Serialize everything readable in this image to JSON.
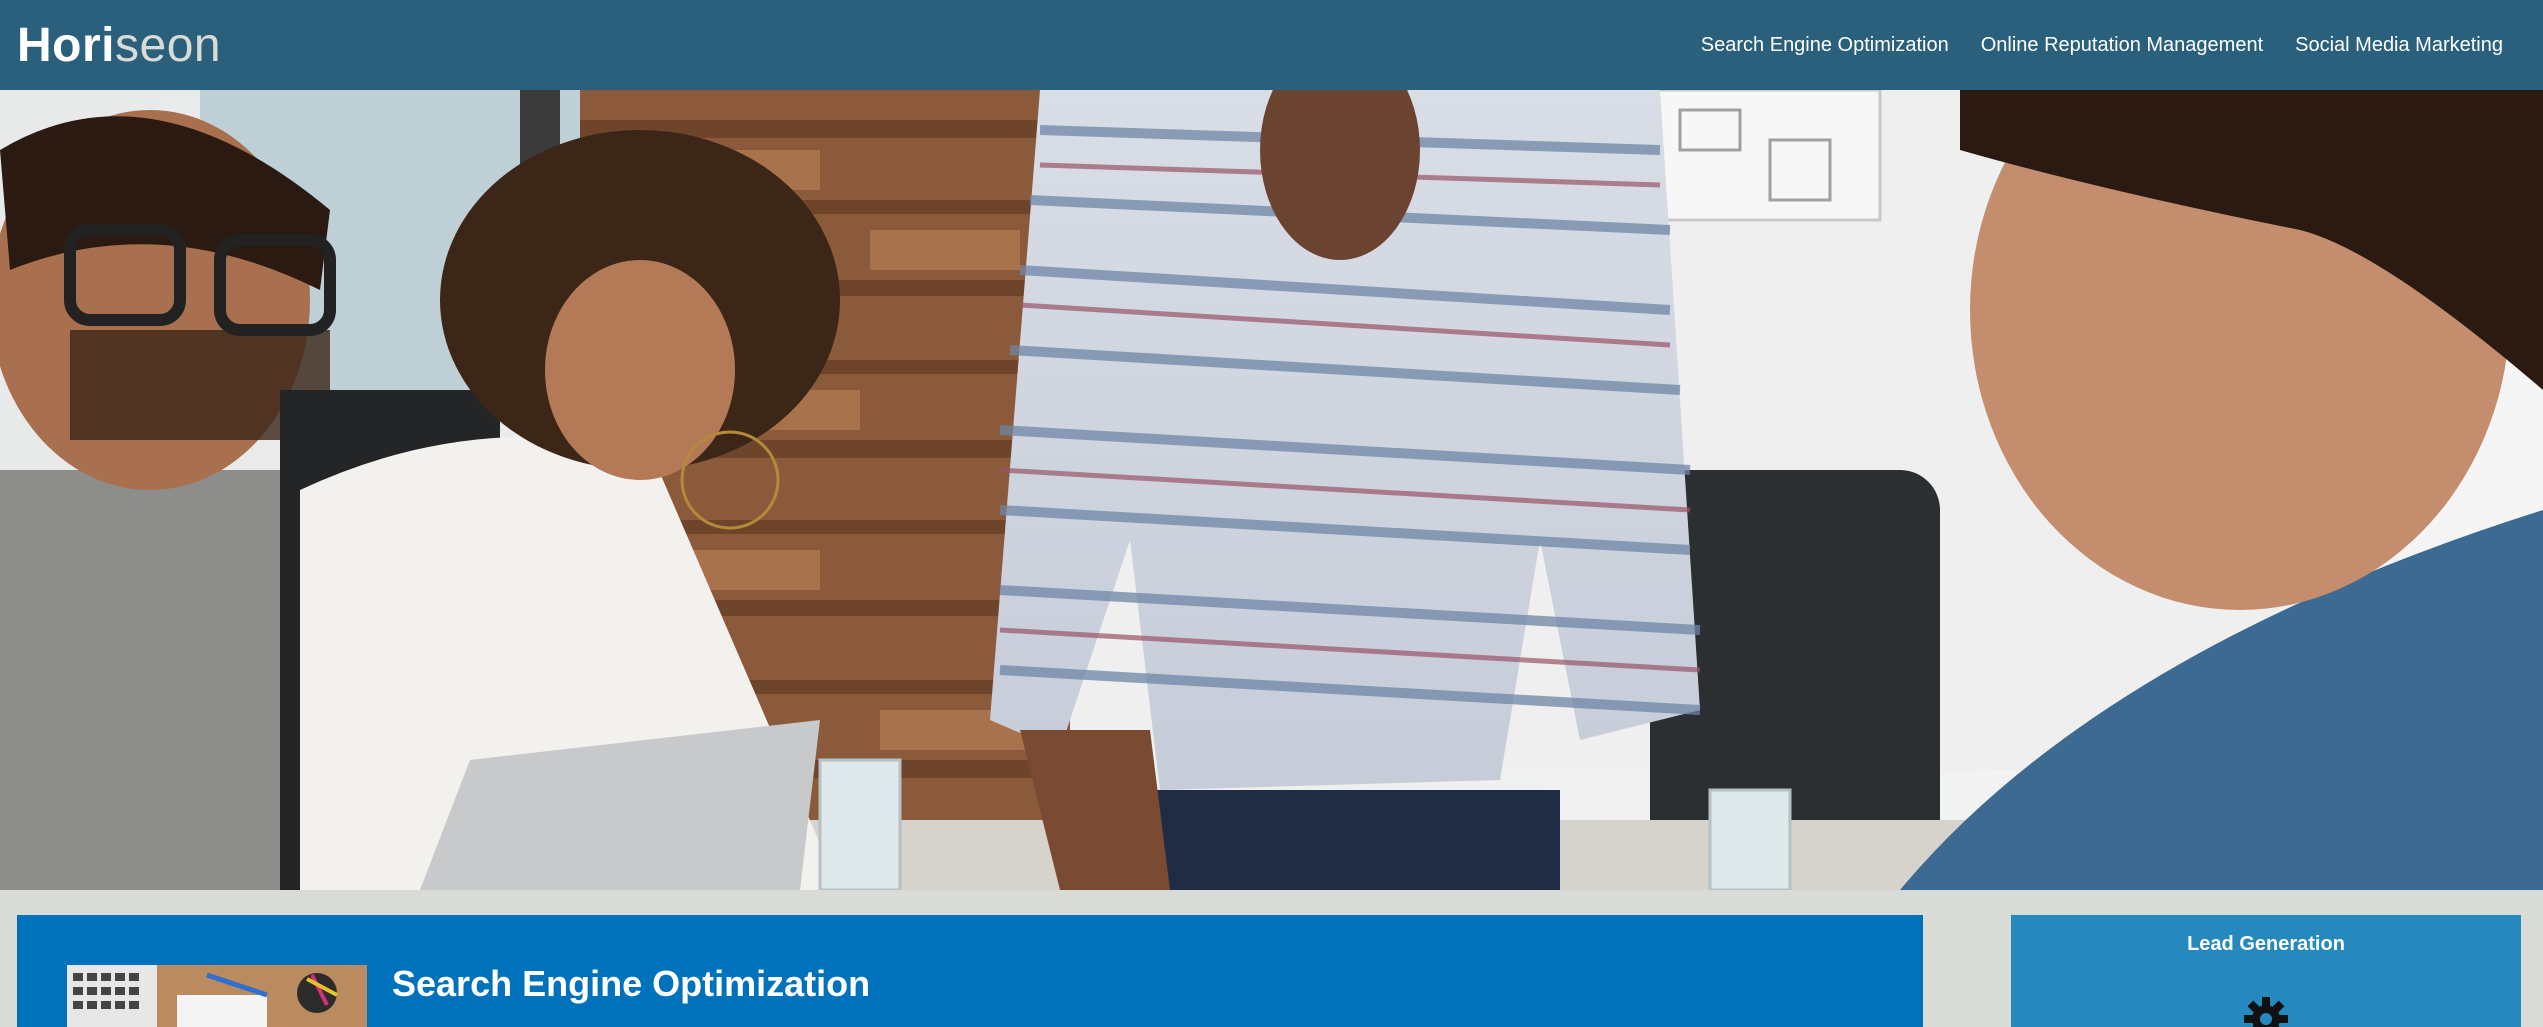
{
  "header": {
    "brand_main": "Hori",
    "brand_accent": "seon",
    "nav": [
      {
        "label": "Search Engine Optimization"
      },
      {
        "label": "Online Reputation Management"
      },
      {
        "label": "Social Media Marketing"
      }
    ]
  },
  "hero": {
    "image": "team-meeting-photo"
  },
  "main": {
    "article_title": "Search Engine Optimization",
    "thumbnail": "desk-workspace-photo"
  },
  "sidebar": {
    "title": "Lead Generation",
    "icon": "gear-icon"
  },
  "colors": {
    "header_bg": "#2a607c",
    "page_bg": "#d9dcd6",
    "article_bg": "#0072bb",
    "sidebar_bg": "#2589bd"
  }
}
